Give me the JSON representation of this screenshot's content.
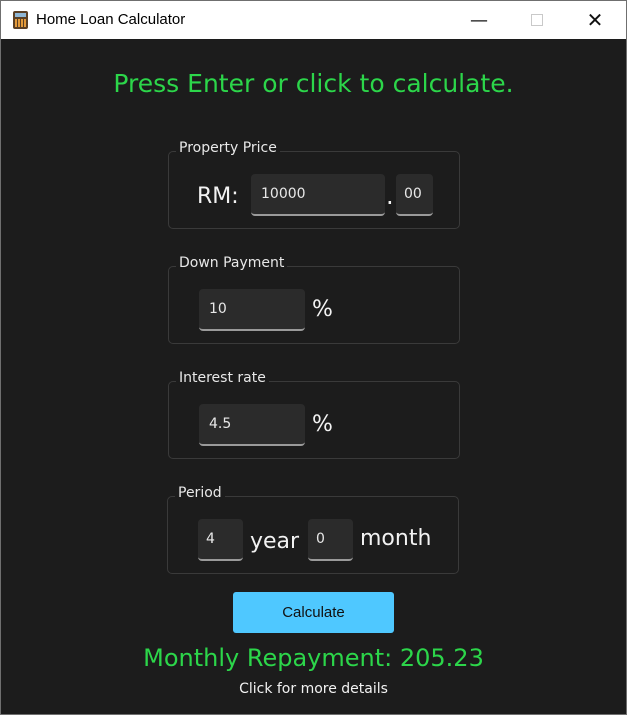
{
  "window": {
    "title": "Home Loan Calculator",
    "controls": {
      "minimize": "—",
      "close": "✕"
    }
  },
  "header": {
    "message": "Press Enter or click to calculate."
  },
  "property_price": {
    "legend": "Property Price",
    "currency": "RM:",
    "whole_value": "10000",
    "separator": ".",
    "cents_value": "00"
  },
  "down_payment": {
    "legend": "Down Payment",
    "value": "10",
    "unit": "%"
  },
  "interest_rate": {
    "legend": "Interest rate",
    "value": "4.5",
    "unit": "%"
  },
  "period": {
    "legend": "Period",
    "years_value": "4",
    "years_unit": "year",
    "months_value": "0",
    "months_unit": "month"
  },
  "actions": {
    "calculate_label": "Calculate"
  },
  "result": {
    "text": "Monthly Repayment: 205.23",
    "details_link": "Click for more details"
  },
  "colors": {
    "accent_green": "#2cd64a",
    "button_blue": "#4fc8ff",
    "background": "#1c1c1c"
  },
  "icons": {
    "app": "calculator-icon",
    "minimize": "minimize-icon",
    "maximize": "maximize-icon",
    "close": "close-icon"
  }
}
